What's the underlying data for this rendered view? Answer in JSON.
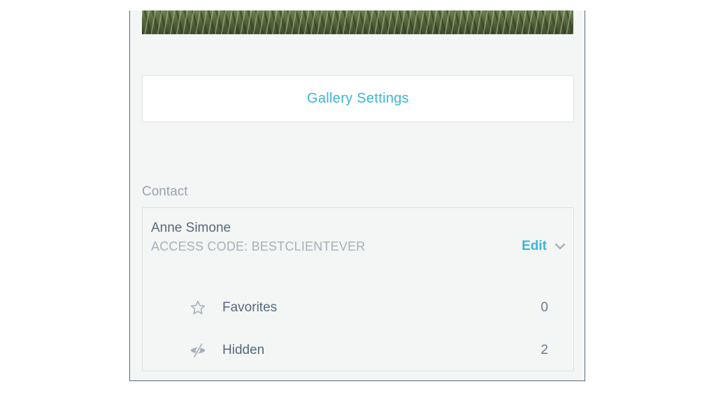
{
  "gallery_settings": {
    "label": "Gallery Settings"
  },
  "contact": {
    "section_label": "Contact",
    "name": "Anne Simone",
    "access_code": "ACCESS CODE: BESTCLIENTEVER",
    "edit_label": "Edit",
    "rows": [
      {
        "icon": "star-outline-icon",
        "label": "Favorites",
        "count": "0"
      },
      {
        "icon": "eye-slash-icon",
        "label": "Hidden",
        "count": "2"
      }
    ]
  },
  "colors": {
    "accent": "#3ab6d6",
    "text_primary": "#56697a",
    "text_muted": "#a7b1b9",
    "panel_bg": "#f4f5f5",
    "border": "#dfe3e6"
  }
}
